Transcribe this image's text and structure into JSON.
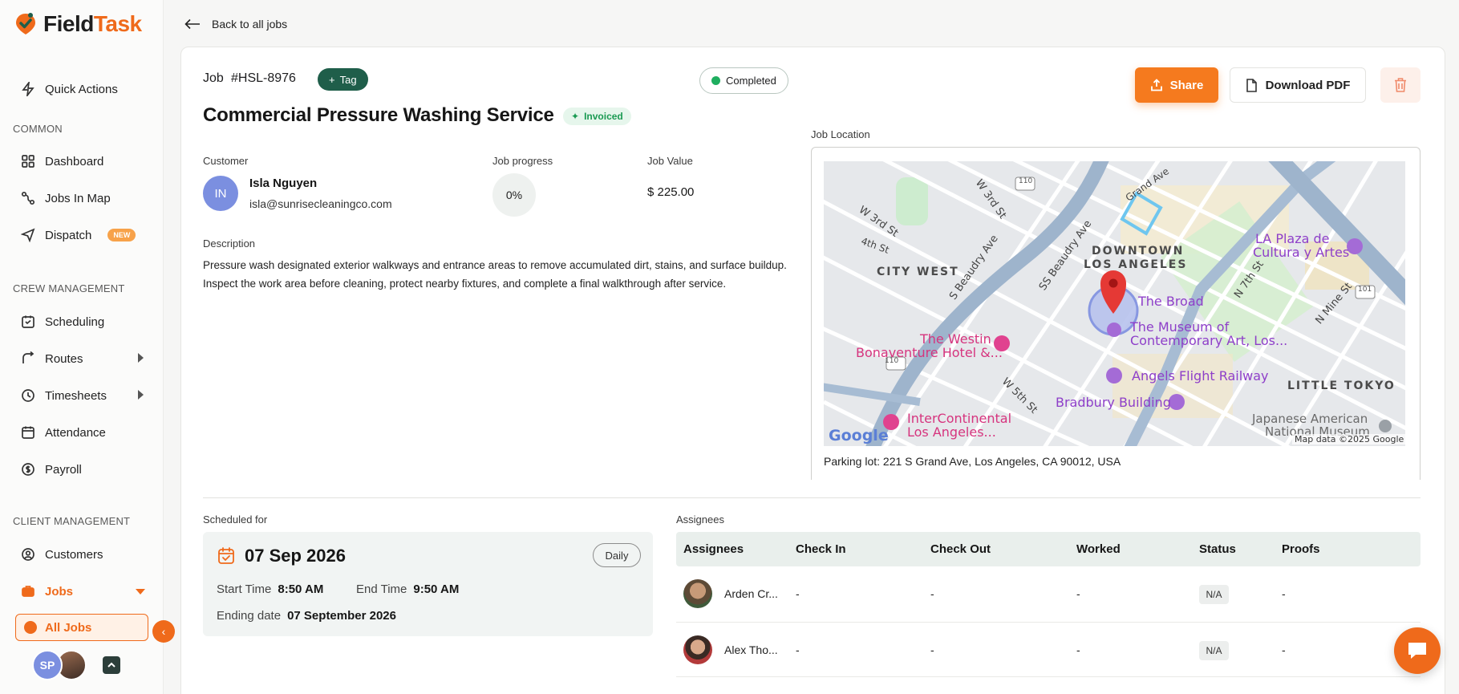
{
  "app": {
    "name_part1": "Field",
    "name_part2": "Task"
  },
  "sidebar": {
    "quick_actions": "Quick Actions",
    "section_common": "COMMON",
    "dashboard": "Dashboard",
    "jobs_in_map": "Jobs In Map",
    "dispatch": "Dispatch",
    "dispatch_badge": "NEW",
    "section_crew": "CREW MANAGEMENT",
    "scheduling": "Scheduling",
    "routes": "Routes",
    "timesheets": "Timesheets",
    "attendance": "Attendance",
    "payroll": "Payroll",
    "section_client": "CLIENT MANAGEMENT",
    "customers": "Customers",
    "jobs": "Jobs",
    "all_jobs": "All Jobs",
    "user_initials": "SP"
  },
  "back_label": "Back to all jobs",
  "job": {
    "label": "Job",
    "id": "#HSL-8976",
    "tag_label": "Tag",
    "status": "Completed",
    "title": "Commercial Pressure Washing Service",
    "invoice_status": "Invoiced",
    "customer_label": "Customer",
    "customer_initials": "IN",
    "customer_name": "Isla Nguyen",
    "customer_email": "isla@sunrisecleaningco.com",
    "progress_label": "Job progress",
    "progress_value": "0%",
    "value_label": "Job Value",
    "value": "$ 225.00",
    "description_label": "Description",
    "description": "Pressure wash designated exterior walkways and entrance areas to remove accumulated dirt, stains, and surface buildup. Inspect the work area before cleaning, protect nearby fixtures, and complete a final walkthrough after service."
  },
  "actions": {
    "share": "Share",
    "download_pdf": "Download PDF"
  },
  "location": {
    "label": "Job Location",
    "address": "Parking lot: 221 S Grand Ave, Los Angeles, CA 90012, USA",
    "map_labels": {
      "downtown1": "DOWNTOWN",
      "downtown2": "LOS ANGELES",
      "city_west": "CITY WEST",
      "little_tokyo": "LITTLE TOKYO",
      "the_broad": "The Broad",
      "moca1": "The Museum of",
      "moca2": "Contemporary Art, Los...",
      "westin1": "The Westin",
      "westin2": "Bonaventure Hotel &...",
      "angels": "Angels Flight Railway",
      "bradbury": "Bradbury Building",
      "interconti1": "InterContinental",
      "interconti2": "Los Angeles...",
      "laplaza1": "LA Plaza de",
      "laplaza2": "Cultura y Artes",
      "jam1": "Japanese American",
      "jam2": "National Museum",
      "w3rd": "W 3rd St",
      "w3rd2": "W 3rd St",
      "w5th": "W 5th St",
      "s_beaudry": "S Beaudry Ave",
      "ss_beaudry": "SS Beaudry Ave",
      "n_mine": "N Mine St",
      "n7th": "N 7th St",
      "fourth": "4th St",
      "grand": "Grand Ave",
      "hwy110a": "110",
      "hwy110b": "110",
      "hwy101": "101",
      "google": "Google",
      "attribution": "Map data ©2025 Google"
    }
  },
  "schedule": {
    "label": "Scheduled for",
    "date": "07 Sep 2026",
    "recurrence": "Daily",
    "start_label": "Start Time",
    "start_value": "8:50 AM",
    "end_label": "End Time",
    "end_value": "9:50 AM",
    "ending_label": "Ending date",
    "ending_value": "07 September 2026"
  },
  "assignees": {
    "label": "Assignees",
    "columns": [
      "Assignees",
      "Check In",
      "Check Out",
      "Worked",
      "Status",
      "Proofs"
    ],
    "rows": [
      {
        "name": "Arden Cr...",
        "check_in": "-",
        "check_out": "-",
        "worked": "-",
        "status": "N/A",
        "proofs": "-"
      },
      {
        "name": "Alex Tho...",
        "check_in": "-",
        "check_out": "-",
        "worked": "-",
        "status": "N/A",
        "proofs": "-"
      }
    ]
  },
  "colors": {
    "brand_orange": "#ef6a1b",
    "brand_green": "#1f5e4a",
    "status_green": "#1fae5f"
  }
}
